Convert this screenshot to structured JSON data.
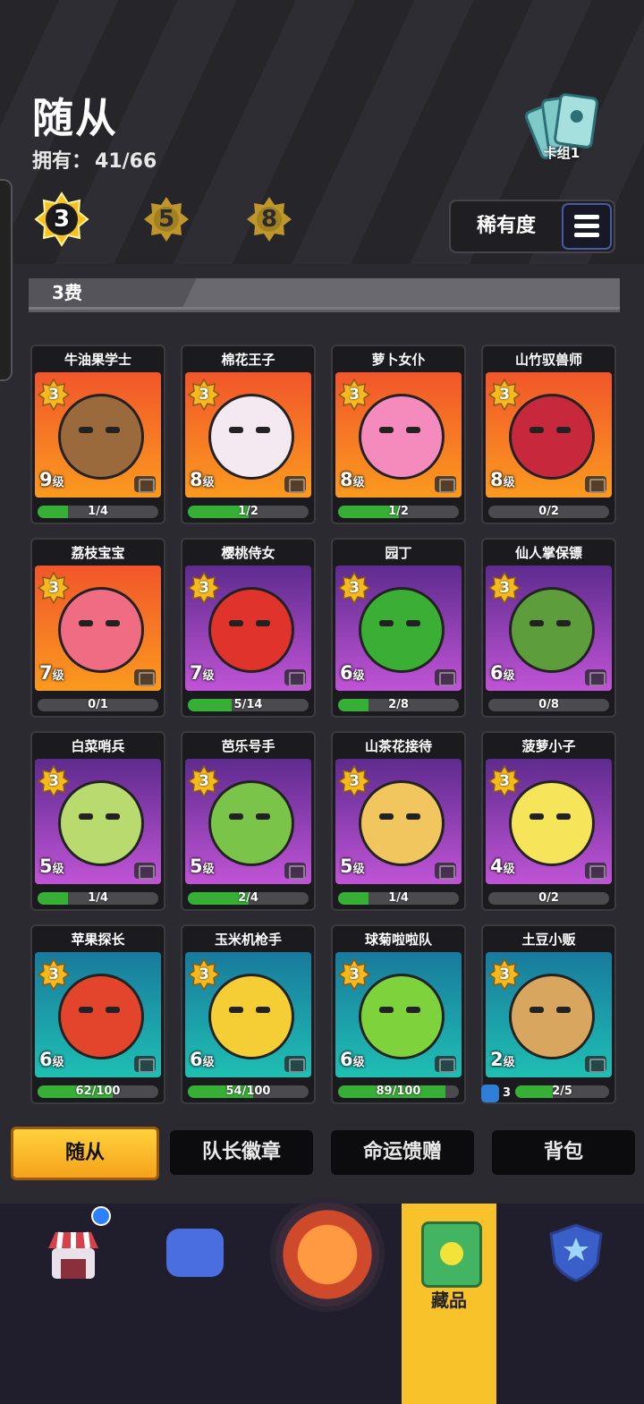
{
  "header": {
    "title": "随从",
    "owned_label": "拥有：",
    "owned_value": "41/66",
    "deck_label": "卡组1"
  },
  "cost_filters": [
    {
      "label": "3",
      "active": true
    },
    {
      "label": "5",
      "active": false
    },
    {
      "label": "8",
      "active": false
    }
  ],
  "sort": {
    "label": "稀有度",
    "icon": "list-icon"
  },
  "section": {
    "title": "3费"
  },
  "cards": [
    {
      "name": "牛油果学士",
      "cost": "3",
      "level": "9",
      "level_unit": "级",
      "progress": "1/4",
      "fill": 0.25,
      "bg": "orange",
      "color": "#9b6a3c"
    },
    {
      "name": "棉花王子",
      "cost": "3",
      "level": "8",
      "level_unit": "级",
      "progress": "1/2",
      "fill": 0.5,
      "bg": "orange",
      "color": "#f4e9f1"
    },
    {
      "name": "萝卜女仆",
      "cost": "3",
      "level": "8",
      "level_unit": "级",
      "progress": "1/2",
      "fill": 0.5,
      "bg": "orange",
      "color": "#f58bbd"
    },
    {
      "name": "山竹驭兽师",
      "cost": "3",
      "level": "8",
      "level_unit": "级",
      "progress": "0/2",
      "fill": 0.0,
      "bg": "orange",
      "color": "#c7283c"
    },
    {
      "name": "荔枝宝宝",
      "cost": "3",
      "level": "7",
      "level_unit": "级",
      "progress": "0/1",
      "fill": 0.0,
      "bg": "orange",
      "color": "#f06c82"
    },
    {
      "name": "樱桃侍女",
      "cost": "3",
      "level": "7",
      "level_unit": "级",
      "progress": "5/14",
      "fill": 0.357,
      "bg": "purple",
      "color": "#e0332c"
    },
    {
      "name": "园丁",
      "cost": "3",
      "level": "6",
      "level_unit": "级",
      "progress": "2/8",
      "fill": 0.25,
      "bg": "purple",
      "color": "#3aae35"
    },
    {
      "name": "仙人掌保镖",
      "cost": "3",
      "level": "6",
      "level_unit": "级",
      "progress": "0/8",
      "fill": 0.0,
      "bg": "purple",
      "color": "#5e9d3c"
    },
    {
      "name": "白菜哨兵",
      "cost": "3",
      "level": "5",
      "level_unit": "级",
      "progress": "1/4",
      "fill": 0.25,
      "bg": "purple",
      "color": "#b8da6f"
    },
    {
      "name": "芭乐号手",
      "cost": "3",
      "level": "5",
      "level_unit": "级",
      "progress": "2/4",
      "fill": 0.5,
      "bg": "purple",
      "color": "#7ac44a"
    },
    {
      "name": "山茶花接待",
      "cost": "3",
      "level": "5",
      "level_unit": "级",
      "progress": "1/4",
      "fill": 0.25,
      "bg": "purple",
      "color": "#f2c65e"
    },
    {
      "name": "菠萝小子",
      "cost": "3",
      "level": "4",
      "level_unit": "级",
      "progress": "0/2",
      "fill": 0.0,
      "bg": "purple",
      "color": "#f6e45a"
    },
    {
      "name": "苹果探长",
      "cost": "3",
      "level": "6",
      "level_unit": "级",
      "progress": "62/100",
      "fill": 0.62,
      "bg": "teal",
      "color": "#e2452c"
    },
    {
      "name": "玉米机枪手",
      "cost": "3",
      "level": "6",
      "level_unit": "级",
      "progress": "54/100",
      "fill": 0.54,
      "bg": "teal",
      "color": "#f5cd34"
    },
    {
      "name": "球菊啦啦队",
      "cost": "3",
      "level": "6",
      "level_unit": "级",
      "progress": "89/100",
      "fill": 0.89,
      "bg": "teal",
      "color": "#7ed23c"
    },
    {
      "name": "土豆小贩",
      "cost": "3",
      "level": "2",
      "level_unit": "级",
      "progress": "2/5",
      "fill": 0.4,
      "bg": "teal",
      "color": "#d9a660",
      "dup_count": "3"
    }
  ],
  "tabs": [
    {
      "label": "随从",
      "active": true
    },
    {
      "label": "队长徽章",
      "active": false
    },
    {
      "label": "命运馈赠",
      "active": false
    },
    {
      "label": "背包",
      "active": false
    }
  ],
  "bottom_nav": {
    "items": [
      "shop-icon",
      "game-controller-icon",
      "battle-glove-icon",
      "collection-book-icon",
      "rank-shield-icon"
    ],
    "active_label": "藏品"
  }
}
